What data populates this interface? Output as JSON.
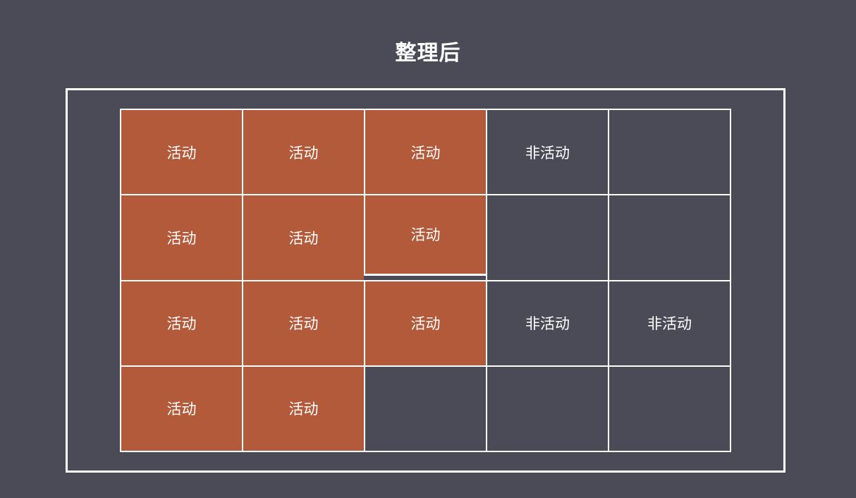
{
  "title": "整理后",
  "cells": [
    {
      "row": 0,
      "col": 0,
      "label": "活动",
      "state": "active"
    },
    {
      "row": 0,
      "col": 1,
      "label": "活动",
      "state": "active"
    },
    {
      "row": 0,
      "col": 2,
      "label": "活动",
      "state": "active"
    },
    {
      "row": 0,
      "col": 3,
      "label": "非活动",
      "state": "inactive"
    },
    {
      "row": 0,
      "col": 4,
      "label": "",
      "state": "empty"
    },
    {
      "row": 1,
      "col": 0,
      "label": "活动",
      "state": "active"
    },
    {
      "row": 1,
      "col": 1,
      "label": "活动",
      "state": "active"
    },
    {
      "row": 1,
      "col": 2,
      "label": "活动",
      "state": "active-short"
    },
    {
      "row": 1,
      "col": 3,
      "label": "",
      "state": "empty"
    },
    {
      "row": 1,
      "col": 4,
      "label": "",
      "state": "empty"
    },
    {
      "row": 2,
      "col": 0,
      "label": "活动",
      "state": "active"
    },
    {
      "row": 2,
      "col": 1,
      "label": "活动",
      "state": "active"
    },
    {
      "row": 2,
      "col": 2,
      "label": "活动",
      "state": "active"
    },
    {
      "row": 2,
      "col": 3,
      "label": "非活动",
      "state": "inactive"
    },
    {
      "row": 2,
      "col": 4,
      "label": "非活动",
      "state": "inactive"
    },
    {
      "row": 3,
      "col": 0,
      "label": "活动",
      "state": "active"
    },
    {
      "row": 3,
      "col": 1,
      "label": "活动",
      "state": "active"
    },
    {
      "row": 3,
      "col": 2,
      "label": "",
      "state": "empty"
    },
    {
      "row": 3,
      "col": 3,
      "label": "",
      "state": "empty"
    },
    {
      "row": 3,
      "col": 4,
      "label": "",
      "state": "empty"
    }
  ],
  "colors": {
    "background": "#4a4b57",
    "active": "#b25a3a",
    "border": "#ffffff"
  }
}
